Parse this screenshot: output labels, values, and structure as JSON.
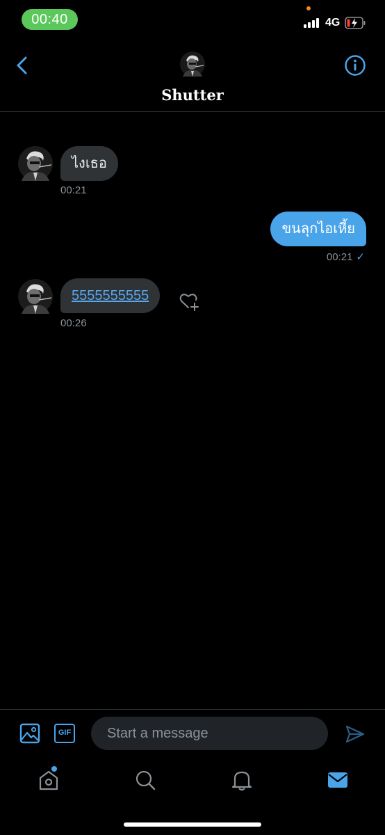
{
  "status_bar": {
    "time": "00:40",
    "network": "4G"
  },
  "header": {
    "title": "Shutter"
  },
  "messages": [
    {
      "direction": "incoming",
      "text": "ไงเธอ",
      "time": "00:21"
    },
    {
      "direction": "outgoing",
      "text": "ขนลุกไอเหี้ย",
      "time": "00:21",
      "status": "✓"
    },
    {
      "direction": "incoming",
      "text": "5555555555",
      "time": "00:26",
      "is_link": true
    }
  ],
  "composer": {
    "placeholder": "Start a message",
    "gif_label": "GIF"
  },
  "tab_bar": {
    "items": [
      {
        "icon": "home-icon",
        "active": false,
        "notification_dot": true
      },
      {
        "icon": "search-icon",
        "active": false
      },
      {
        "icon": "notifications-icon",
        "active": false
      },
      {
        "icon": "messages-icon",
        "active": true
      }
    ]
  },
  "colors": {
    "accent": "#4aa4ea",
    "incoming_bubble": "#2f3336",
    "outgoing_bubble": "#4aa4ea",
    "status_time_pill": "#5ac85a",
    "background": "#000000"
  },
  "icons": {
    "back": "chevron-left-icon",
    "info": "info-icon",
    "media": "image-icon",
    "gif": "gif-icon",
    "send": "send-icon",
    "react": "heart-plus-icon"
  }
}
